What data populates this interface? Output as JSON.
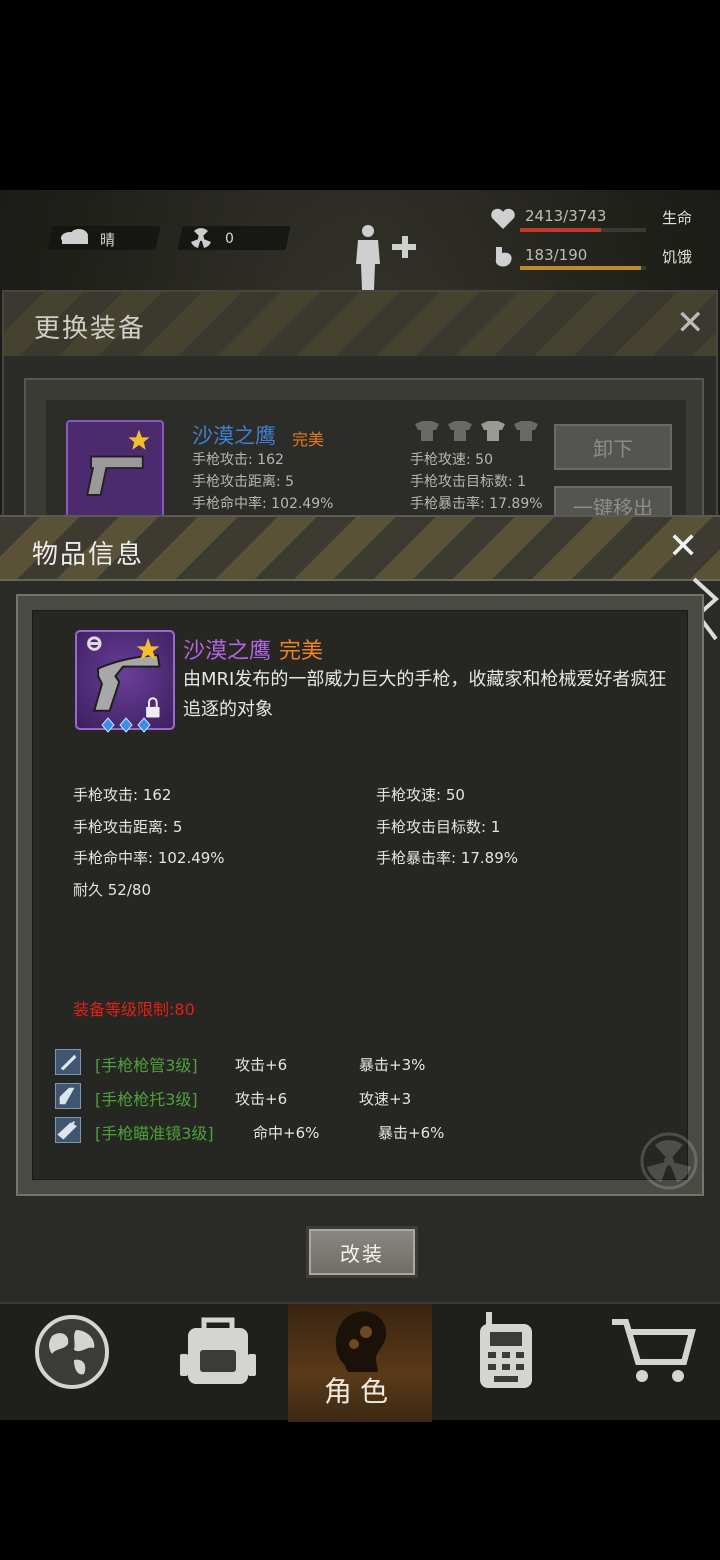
{
  "status_bar": {
    "weather": "晴",
    "radiation": "0",
    "health": {
      "value": "2413/3743",
      "label": "生命",
      "fraction": 0.645
    },
    "hunger": {
      "value": "183/190",
      "label": "饥饿",
      "fraction": 0.963
    }
  },
  "equip_panel": {
    "title": "更换装备",
    "item_name": "沙漠之鹰",
    "item_quality": "完美",
    "stats": {
      "attack": "手枪攻击: 162",
      "speed": "手枪攻速: 50",
      "range": "手枪攻击距离: 5",
      "targets": "手枪攻击目标数: 1",
      "accuracy": "手枪命中率: 102.49%",
      "crit": "手枪暴击率: 17.89%"
    },
    "unequip_label": "卸下",
    "move_out_label": "一键移出"
  },
  "item_info": {
    "title": "物品信息",
    "name": "沙漠之鹰",
    "quality": "完美",
    "description": "由MRI发布的一部威力巨大的手枪，收藏家和枪械爱好者疯狂追逐的对象",
    "stats": {
      "attack": "手枪攻击: 162",
      "speed": "手枪攻速: 50",
      "range": "手枪攻击距离: 5",
      "targets": "手枪攻击目标数: 1",
      "accuracy": "手枪命中率: 102.49%",
      "crit": "手枪暴击率: 17.89%",
      "durability": "耐久 52/80"
    },
    "level_requirement": "装备等级限制:80",
    "mods": [
      {
        "name": "[手枪枪管3级]",
        "stat1": "攻击+6",
        "stat2": "暴击+3%"
      },
      {
        "name": "[手枪枪托3级]",
        "stat1": "攻击+6",
        "stat2": "攻速+3"
      },
      {
        "name": "[手枪瞄准镜3级]",
        "stat1": "命中+6%",
        "stat2": "暴击+6%"
      }
    ],
    "modify_label": "改装"
  },
  "bottom_nav": {
    "active_label": "角色",
    "tabs": [
      "globe-icon",
      "backpack-icon",
      "character-icon",
      "radio-icon",
      "cart-icon"
    ]
  },
  "colors": {
    "quality_orange": "#ef8220",
    "name_purple": "#b565e6",
    "mod_green": "#4fa03a",
    "requirement_red": "#e0201a"
  }
}
